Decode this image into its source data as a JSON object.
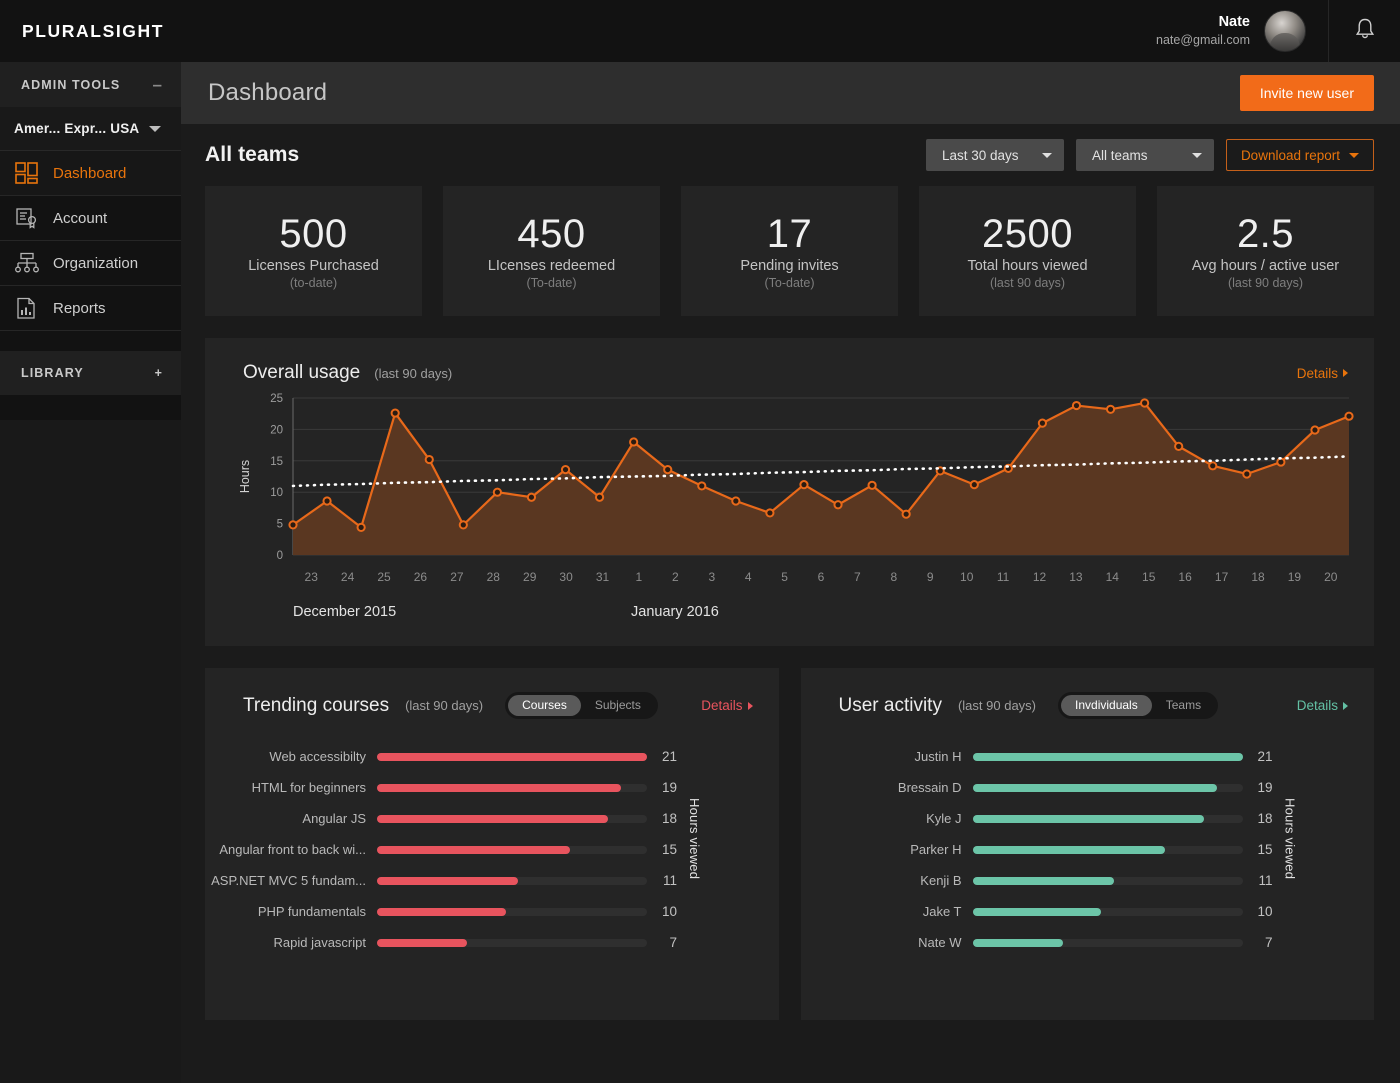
{
  "brand": "PLURALSIGHT",
  "sidebar": {
    "admin_tools_label": "ADMIN TOOLS",
    "admin_tools_sign": "–",
    "org": "Amer... Expr... USA",
    "items": [
      {
        "label": "Dashboard",
        "icon": "dashboard-icon"
      },
      {
        "label": "Account",
        "icon": "account-icon"
      },
      {
        "label": "Organization",
        "icon": "organization-icon"
      },
      {
        "label": "Reports",
        "icon": "reports-icon"
      }
    ],
    "library_label": "LIBRARY",
    "library_sign": "+"
  },
  "topbar": {
    "user_name": "Nate",
    "user_email": "nate@gmail.com",
    "bell_icon": "bell-icon",
    "avatar_icon": "avatar"
  },
  "pagehead": {
    "title": "Dashboard",
    "invite_label": "Invite new user"
  },
  "toolbar": {
    "heading": "All teams",
    "date_filter": "Last 30 days",
    "team_filter": "All teams",
    "download_label": "Download report"
  },
  "stats": [
    {
      "value": "500",
      "label": "Licenses Purchased",
      "sub": "(to-date)"
    },
    {
      "value": "450",
      "label": "LIcenses redeemed",
      "sub": "(To-date)"
    },
    {
      "value": "17",
      "label": "Pending invites",
      "sub": "(To-date)"
    },
    {
      "value": "2500",
      "label": "Total hours viewed",
      "sub": "(last 90 days)"
    },
    {
      "value": "2.5",
      "label": "Avg hours / active user",
      "sub": "(last 90 days)"
    }
  ],
  "usage": {
    "title": "Overall usage",
    "subtitle": "(last 90 days)",
    "details_label": "Details",
    "month_left": "December 2015",
    "month_right": "January 2016"
  },
  "trending": {
    "title": "Trending courses",
    "subtitle": "(last 90 days)",
    "toggle": [
      "Courses",
      "Subjects"
    ],
    "toggle_active": "Courses",
    "details_label": "Details",
    "axis_label": "Hours viewed",
    "color": "#e8545e",
    "rows": [
      {
        "name": "Web accessibilty",
        "value": 21
      },
      {
        "name": "HTML for beginners",
        "value": 19
      },
      {
        "name": "Angular JS",
        "value": 18
      },
      {
        "name": "Angular front to back wi...",
        "value": 15
      },
      {
        "name": "ASP.NET MVC 5 fundam...",
        "value": 11
      },
      {
        "name": "PHP fundamentals",
        "value": 10
      },
      {
        "name": "Rapid javascript",
        "value": 7
      }
    ]
  },
  "user_activity": {
    "title": "User activity",
    "subtitle": "(last 90 days)",
    "toggle": [
      "Invdividuals",
      "Teams"
    ],
    "toggle_active": "Invdividuals",
    "details_label": "Details",
    "axis_label": "Hours viewed",
    "color": "#6cc5a8",
    "rows": [
      {
        "name": "Justin H",
        "value": 21
      },
      {
        "name": "Bressain D",
        "value": 19
      },
      {
        "name": "Kyle J",
        "value": 18
      },
      {
        "name": "Parker H",
        "value": 15
      },
      {
        "name": "Kenji B",
        "value": 11
      },
      {
        "name": "Jake T",
        "value": 10
      },
      {
        "name": "Nate W",
        "value": 7
      }
    ]
  },
  "colors": {
    "accent_orange": "#e8740c",
    "invite_orange": "#f26b19",
    "line_orange": "#e8691a",
    "area_brown": "#5a3721",
    "trend_red": "#e8545e",
    "activity_green": "#6cc5a8"
  },
  "chart_data": {
    "type": "area",
    "title": "Overall usage",
    "subtitle": "(last 90 days)",
    "xlabel": "",
    "ylabel": "Hours",
    "ylim": [
      0,
      25
    ],
    "yticks": [
      0,
      5,
      10,
      15,
      20,
      25
    ],
    "grid": true,
    "legend": "none",
    "x_tick_labels": [
      "23",
      "24",
      "25",
      "26",
      "27",
      "28",
      "29",
      "30",
      "31",
      "1",
      "2",
      "3",
      "4",
      "5",
      "6",
      "7",
      "8",
      "9",
      "10",
      "11",
      "12",
      "13",
      "14",
      "15",
      "16",
      "17",
      "18",
      "19",
      "20"
    ],
    "x_group_labels": [
      "December 2015",
      "January 2016"
    ],
    "series": [
      {
        "name": "Hours viewed",
        "type": "area-line",
        "color": "#e8691a",
        "fill": "#5a3721",
        "values": [
          4.8,
          8.6,
          4.4,
          22.6,
          15.2,
          4.8,
          10.0,
          9.2,
          13.6,
          9.2,
          18.0,
          13.6,
          11.0,
          8.6,
          6.7,
          11.2,
          8.0,
          11.1,
          6.5,
          13.4,
          11.2,
          13.8,
          21.0,
          23.8,
          23.2,
          24.2,
          17.3,
          14.2,
          12.9,
          14.8,
          19.9,
          22.1
        ]
      },
      {
        "name": "Trend",
        "type": "dotted-line",
        "color": "#ffffff",
        "values": [
          11.0,
          11.2,
          11.3,
          11.5,
          11.6,
          11.8,
          11.9,
          12.1,
          12.2,
          12.4,
          12.5,
          12.6,
          12.8,
          12.9,
          13.1,
          13.2,
          13.4,
          13.5,
          13.7,
          13.8,
          14.0,
          14.1,
          14.3,
          14.4,
          14.6,
          14.7,
          14.9,
          15.0,
          15.2,
          15.4,
          15.5,
          15.7
        ]
      }
    ]
  }
}
